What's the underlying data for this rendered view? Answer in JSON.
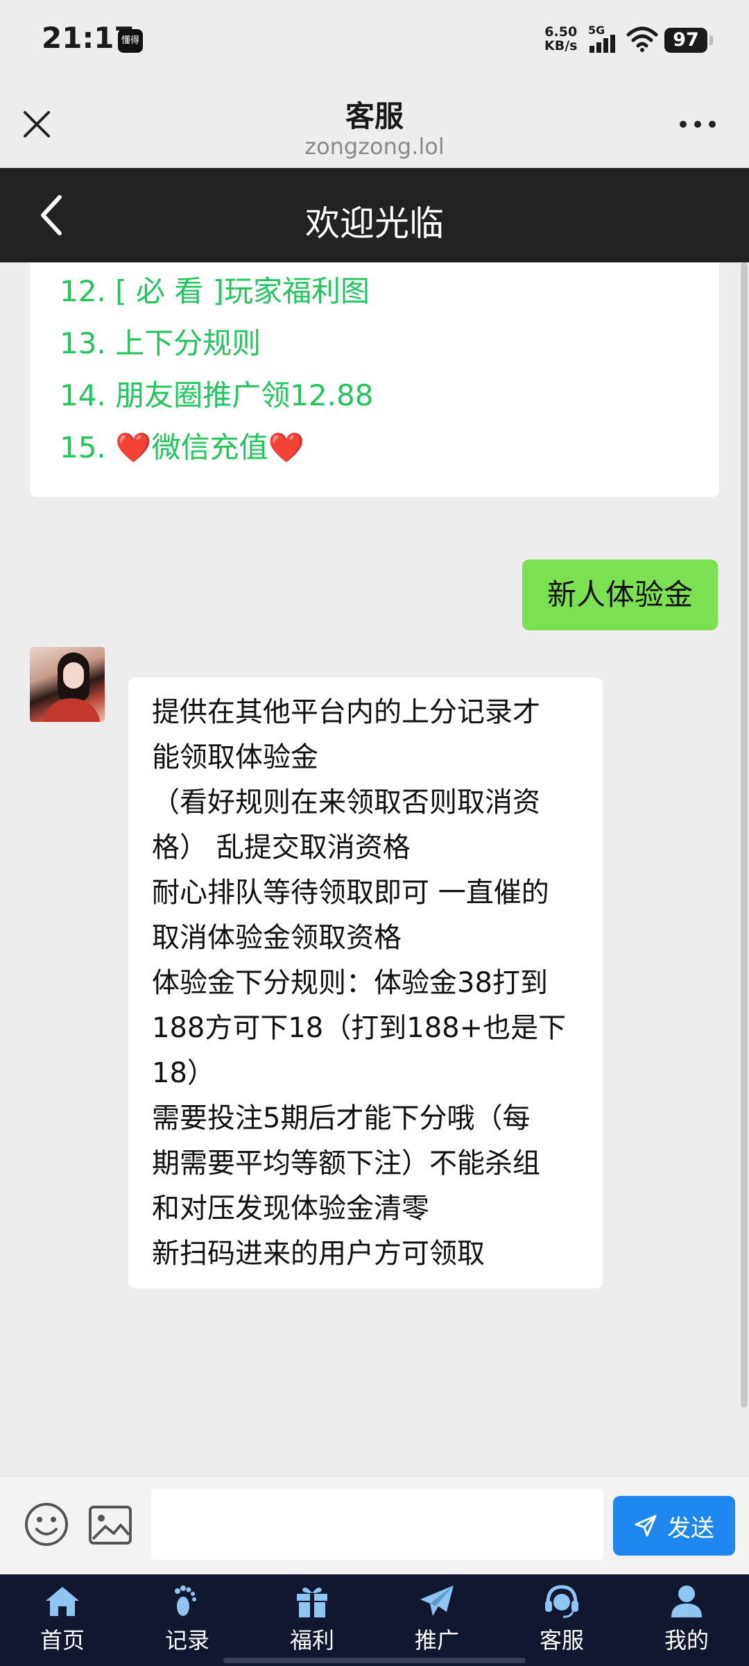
{
  "status_bar": {
    "time": "21:17",
    "app_badge": "懂得",
    "speed_value": "6.50",
    "speed_unit": "KB/s",
    "network": "5G",
    "battery": "97"
  },
  "browser_header": {
    "title": "客服",
    "url": "zongzong.lol"
  },
  "title_bar": {
    "title": "欢迎光临"
  },
  "menu": {
    "items": [
      "12. [ 必 看 ]玩家福利图",
      "13. 上下分规则",
      "14. 朋友圈推广领12.88"
    ],
    "item15_prefix": "15. ",
    "item15_text": "微信充值",
    "heart": "❤️"
  },
  "sent_message": "新人体验金",
  "received_message": {
    "lines": [
      "提供在其他平台内的上分记录才",
      "能领取体验金",
      "（看好规则在来领取否则取消资",
      "格） 乱提交取消资格",
      "耐心排队等待领取即可 一直催的",
      "取消体验金领取资格",
      "体验金下分规则：体验金38打到",
      "188方可下18（打到188+也是下",
      "18）",
      "需要投注5期后才能下分哦（每",
      "期需要平均等额下注）不能杀组",
      "和对压发现体验金清零",
      "新扫码进来的用户方可领取"
    ]
  },
  "input_bar": {
    "placeholder": "",
    "send_label": "发送"
  },
  "bottom_nav": {
    "items": [
      {
        "label": "首页",
        "icon": "home-icon"
      },
      {
        "label": "记录",
        "icon": "footprint-icon"
      },
      {
        "label": "福利",
        "icon": "gift-icon"
      },
      {
        "label": "推广",
        "icon": "paper-plane-icon"
      },
      {
        "label": "客服",
        "icon": "headset-icon"
      },
      {
        "label": "我的",
        "icon": "user-icon"
      }
    ]
  }
}
